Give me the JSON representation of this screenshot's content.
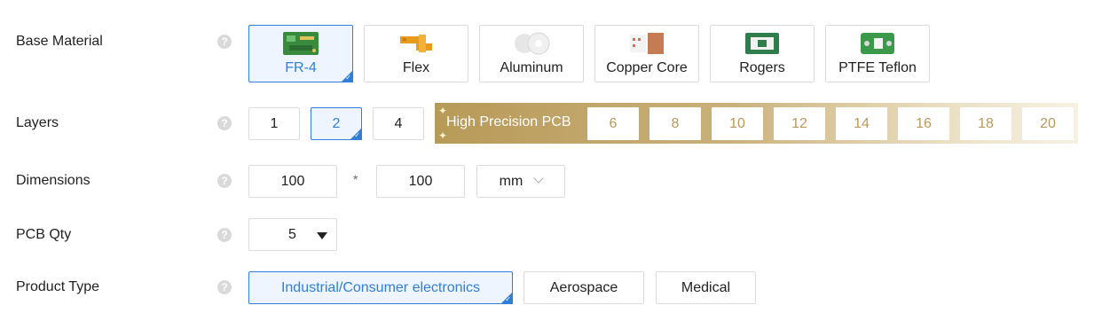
{
  "help_symbol": "?",
  "base_material": {
    "label": "Base Material",
    "options": [
      {
        "label": "FR-4",
        "icon": "fr4-board-icon",
        "selected": true
      },
      {
        "label": "Flex",
        "icon": "flex-pcb-icon",
        "selected": false
      },
      {
        "label": "Aluminum",
        "icon": "aluminum-pcb-icon",
        "selected": false
      },
      {
        "label": "Copper Core",
        "icon": "copper-core-pcb-icon",
        "selected": false
      },
      {
        "label": "Rogers",
        "icon": "rogers-pcb-icon",
        "selected": false
      },
      {
        "label": "PTFE Teflon",
        "icon": "ptfe-teflon-pcb-icon",
        "selected": false
      }
    ]
  },
  "layers": {
    "label": "Layers",
    "options": [
      "1",
      "2",
      "4"
    ],
    "selected": "2",
    "high_precision_label": "High Precision PCB",
    "high_precision_options": [
      "6",
      "8",
      "10",
      "12",
      "14",
      "16",
      "18",
      "20"
    ]
  },
  "dimensions": {
    "label": "Dimensions",
    "width": "100",
    "separator": "*",
    "height": "100",
    "unit": "mm"
  },
  "pcb_qty": {
    "label": "PCB Qty",
    "value": "5"
  },
  "product_type": {
    "label": "Product Type",
    "options": [
      "Industrial/Consumer electronics",
      "Aerospace",
      "Medical"
    ],
    "selected": "Industrial/Consumer electronics"
  },
  "colors": {
    "accent": "#2f7fd8",
    "gold": "#b8995a"
  }
}
